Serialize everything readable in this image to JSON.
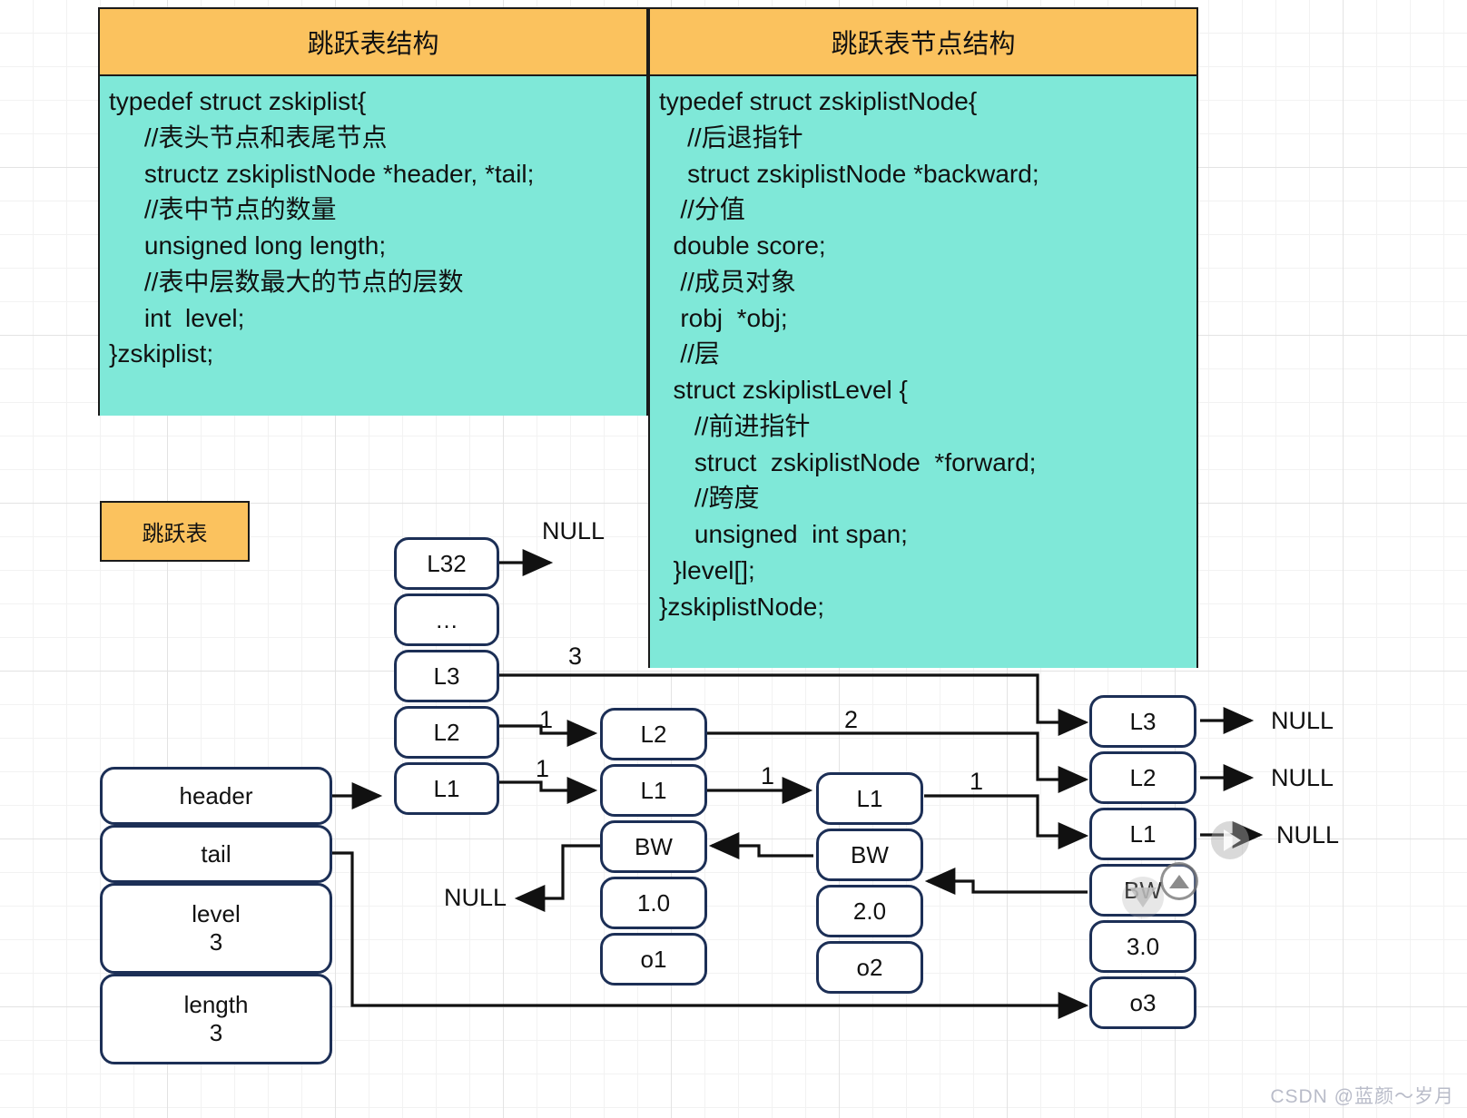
{
  "panels": {
    "left": {
      "title": "跳跃表结构",
      "code": "typedef struct zskiplist{\n     //表头节点和表尾节点\n     structz zskiplistNode *header, *tail;\n     //表中节点的数量\n     unsigned long length;\n     //表中层数最大的节点的层数\n     int  level;\n}zskiplist;"
    },
    "right": {
      "title": "跳跃表节点结构",
      "code": "typedef struct zskiplistNode{\n    //后退指针\n    struct zskiplistNode *backward;\n   //分值\n  double score;\n   //成员对象\n   robj  *obj;\n   //层\n  struct zskiplistLevel {\n     //前进指针\n     struct  zskiplistNode  *forward;\n     //跨度\n     unsigned  int span;\n  }level[];\n}zskiplistNode;"
    }
  },
  "legend": {
    "tag": "跳跃表"
  },
  "skiplist_struct": {
    "header": "header",
    "tail": "tail",
    "level_label": "level",
    "level_value": "3",
    "length_label": "length",
    "length_value": "3"
  },
  "head_tower": {
    "levels": [
      "L32",
      "…",
      "L3",
      "L2",
      "L1"
    ]
  },
  "nodes": [
    {
      "id": "node1",
      "levels": [
        "L2",
        "L1"
      ],
      "backward": "BW",
      "score": "1.0",
      "obj": "o1"
    },
    {
      "id": "node2",
      "levels": [
        "L1"
      ],
      "backward": "BW",
      "score": "2.0",
      "obj": "o2"
    },
    {
      "id": "node3",
      "levels": [
        "L3",
        "L2",
        "L1"
      ],
      "backward": "BW",
      "score": "3.0",
      "obj": "o3"
    }
  ],
  "spans": {
    "head_to_n1_l2": "1",
    "head_to_n1_l1": "1",
    "head_to_n3_l3": "3",
    "n1_to_n3_l2": "2",
    "n1_to_n2_l1": "1",
    "n2_to_n3_l1": "1"
  },
  "nulls": {
    "head_l32": "NULL",
    "n1_backward": "NULL",
    "n3_l3": "NULL",
    "n3_l2": "NULL",
    "n3_l1": "NULL"
  },
  "overlay": {
    "nav_right_icon": "play-right-icon",
    "nav_up_icon": "chevron-up-icon",
    "nav_down_icon": "chevron-down-icon"
  },
  "watermark": "CSDN @蓝颜～岁月"
}
